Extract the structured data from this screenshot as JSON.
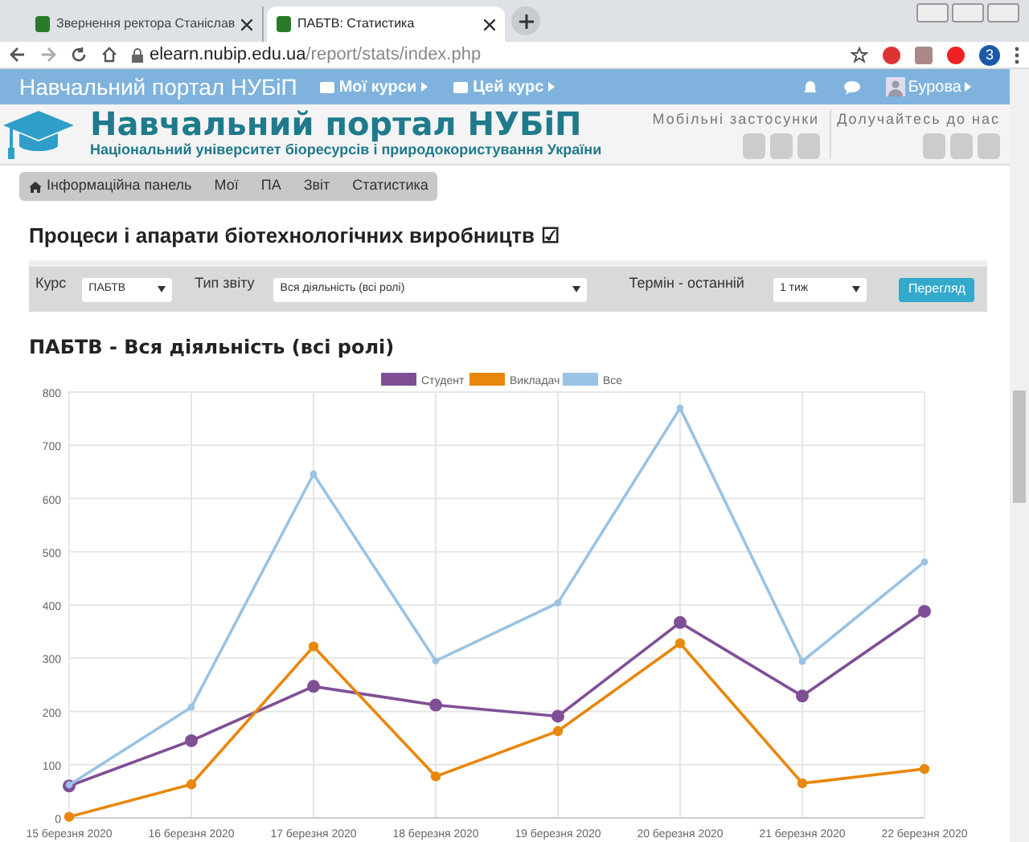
{
  "browser": {
    "tabs": [
      {
        "title": "Звернення ректора Станіслав",
        "selected": false
      },
      {
        "title": "ПАБТВ: Статистика",
        "selected": true
      }
    ],
    "url_host": "elearn.nubip.edu.ua",
    "url_path": "/report/stats/index.php",
    "profile_badge": "3"
  },
  "navbar": {
    "brand": "Навчальний портал НУБіП",
    "items": [
      "Мої курси",
      "Цей курс"
    ],
    "user": "Бурова"
  },
  "header": {
    "title": "Навчальний портал НУБіП",
    "subtitle": "Національний університет біоресурсів і природокористування України",
    "mobile_label": "Мобільні застосунки",
    "social_label": "Долучайтесь до нас"
  },
  "breadcrumb": [
    "Інформаційна панель",
    "Мої",
    "ПА",
    "Звіт",
    "Статистика"
  ],
  "course_title": "Процеси і апарати біотехнологічних виробництв",
  "course_title_mark": "☑",
  "filters": {
    "course_label": "Курс",
    "course_value": "ПАБТВ",
    "type_label": "Тип звіту",
    "type_value": "Вся діяльність (всі ролі)",
    "term_label": "Термін - останній",
    "term_value": "1 тиж",
    "button": "Перегляд"
  },
  "report": {
    "title": "ПАБТВ - Вся діяльність (всі ролі)",
    "chart_data": {
      "type": "line",
      "categories": [
        "15 березня 2020",
        "16 березня 2020",
        "17 березня 2020",
        "18 березня 2020",
        "19 березня 2020",
        "20 березня 2020",
        "21 березня 2020",
        "22 березня 2020"
      ],
      "series": [
        {
          "name": "Студент",
          "color": "#7f4f96",
          "marker": true,
          "values": [
            60,
            145,
            247,
            212,
            191,
            367,
            229,
            388
          ]
        },
        {
          "name": "Викладач",
          "color": "#e8870c",
          "marker": true,
          "values": [
            2,
            63,
            322,
            78,
            163,
            328,
            65,
            92
          ]
        },
        {
          "name": "Все",
          "color": "#9ac3e4",
          "marker": true,
          "values": [
            62,
            208,
            646,
            295,
            404,
            770,
            294,
            481
          ]
        }
      ],
      "grid": true,
      "legend": true,
      "ylim": [
        0,
        800
      ],
      "yticks": [
        0,
        100,
        200,
        300,
        400,
        500,
        600,
        700,
        800
      ]
    }
  }
}
